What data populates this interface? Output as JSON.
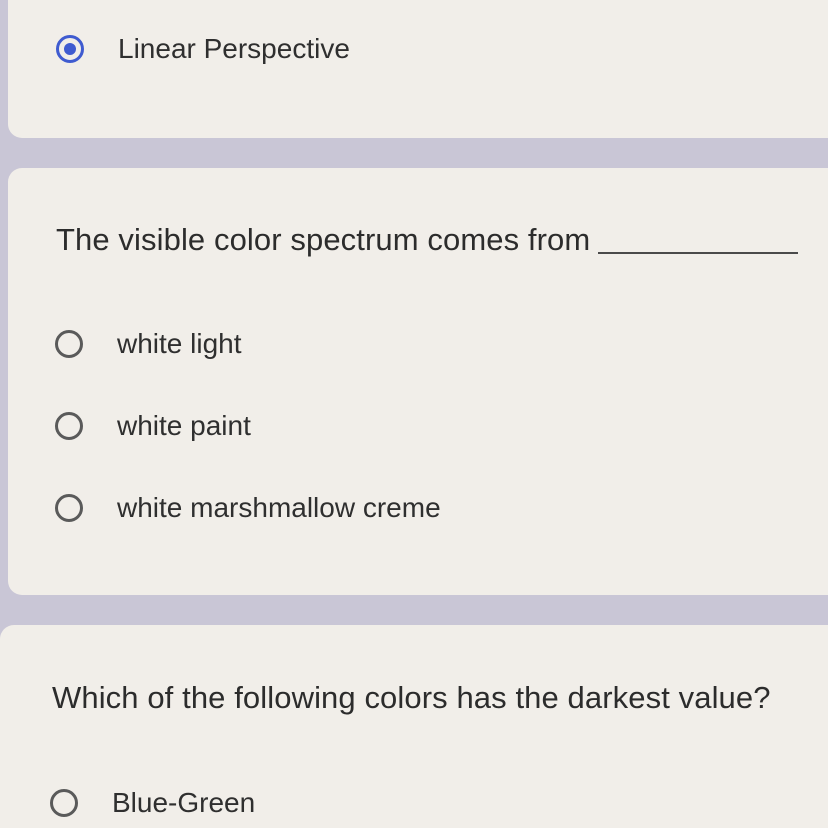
{
  "questions": [
    {
      "options": [
        {
          "label": "Linear Perspective",
          "selected": true
        }
      ]
    },
    {
      "text": "The visible color spectrum comes from",
      "options": [
        {
          "label": "white light",
          "selected": false
        },
        {
          "label": "white paint",
          "selected": false
        },
        {
          "label": "white marshmallow creme",
          "selected": false
        }
      ]
    },
    {
      "text": "Which of the following colors has the darkest value?",
      "options": [
        {
          "label": "Blue-Green",
          "selected": false
        }
      ]
    }
  ],
  "colors": {
    "page_background": "#c9c6d6",
    "card_background": "#f1eee9",
    "radio_selected": "#3f5bd0",
    "radio_unselected": "#5a5a5a"
  }
}
